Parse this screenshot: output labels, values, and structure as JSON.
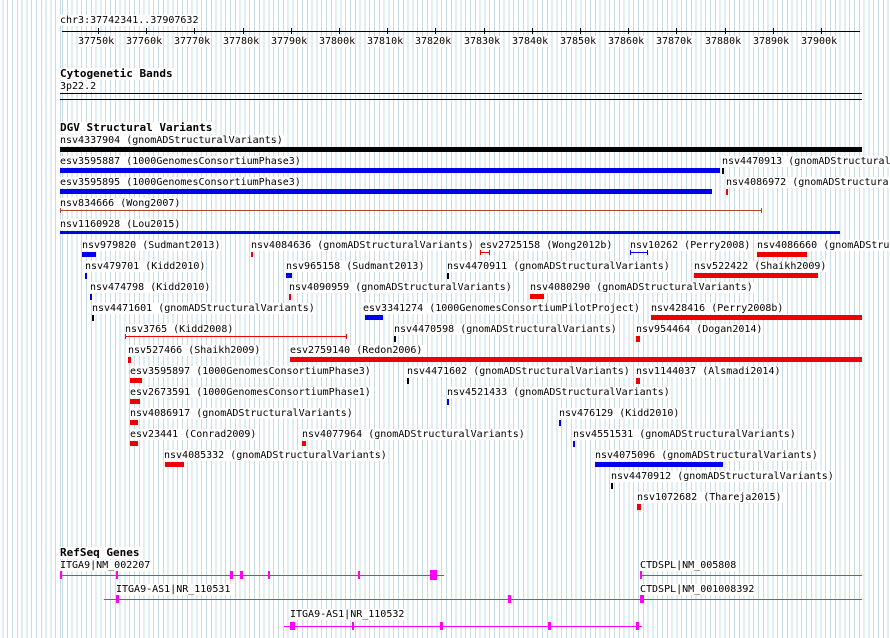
{
  "ruler": {
    "position": "chr3:37742341..37907632",
    "ticks": [
      "37750k",
      "37760k",
      "37770k",
      "37780k",
      "37790k",
      "37800k",
      "37810k",
      "37820k",
      "37830k",
      "37840k",
      "37850k",
      "37860k",
      "37870k",
      "37880k",
      "37890k",
      "37900k"
    ]
  },
  "tracks": {
    "cyto": {
      "title": "Cytogenetic Bands",
      "band": "3p22.2"
    },
    "dgv": {
      "title": "DGV Structural Variants"
    },
    "refseq": {
      "title": "RefSeq Genes"
    }
  },
  "colors": {
    "blue": "#0000ee",
    "red": "#ee0000",
    "black": "#000000",
    "brown": "#a84a2a",
    "magenta": "#ff00ff",
    "grid": "#c7dbe8"
  },
  "variants": [
    {
      "label": "nsv4337904 (gnomADStructuralVariants)",
      "color": "black"
    },
    {
      "label": "esv3595887 (1000GenomesConsortiumPhase3)",
      "color": "blue"
    },
    {
      "label": "nsv4470913 (gnomADStructural",
      "color": "black"
    },
    {
      "label": "esv3595895 (1000GenomesConsortiumPhase3)",
      "color": "blue"
    },
    {
      "label": "nsv4086972 (gnomADStructura",
      "color": "red"
    },
    {
      "label": "nsv834666 (Wong2007)",
      "color": "brown"
    },
    {
      "label": "nsv1160928 (Lou2015)",
      "color": "blue"
    },
    {
      "label": "nsv979820 (Sudmant2013)",
      "color": "blue"
    },
    {
      "label": "nsv4084636 (gnomADStructuralVariants)",
      "color": "red"
    },
    {
      "label": "esv2725158 (Wong2012b)",
      "color": "red"
    },
    {
      "label": "nsv10262 (Perry2008)",
      "color": "blue"
    },
    {
      "label": "nsv4086660 (gnomADStruc",
      "color": "red"
    },
    {
      "label": "nsv479701 (Kidd2010)",
      "color": "blue"
    },
    {
      "label": "nsv965158 (Sudmant2013)",
      "color": "blue"
    },
    {
      "label": "nsv4470911 (gnomADStructuralVariants)",
      "color": "black"
    },
    {
      "label": "nsv522422 (Shaikh2009)",
      "color": "red"
    },
    {
      "label": "nsv474798 (Kidd2010)",
      "color": "blue"
    },
    {
      "label": "nsv4090959 (gnomADStructuralVariants)",
      "color": "red"
    },
    {
      "label": "nsv4080290 (gnomADStructuralVariants)",
      "color": "red"
    },
    {
      "label": "nsv4471601 (gnomADStructuralVariants)",
      "color": "black"
    },
    {
      "label": "esv3341274 (1000GenomesConsortiumPilotProject)",
      "color": "blue"
    },
    {
      "label": "nsv428416 (Perry2008b)",
      "color": "red"
    },
    {
      "label": "nsv3765 (Kidd2008)",
      "color": "red"
    },
    {
      "label": "nsv4470598 (gnomADStructuralVariants)",
      "color": "black"
    },
    {
      "label": "nsv954464 (Dogan2014)",
      "color": "red"
    },
    {
      "label": "nsv527466 (Shaikh2009)",
      "color": "red"
    },
    {
      "label": "esv2759140 (Redon2006)",
      "color": "red"
    },
    {
      "label": "esv3595897 (1000GenomesConsortiumPhase3)",
      "color": "red"
    },
    {
      "label": "nsv4471602 (gnomADStructuralVariants)",
      "color": "black"
    },
    {
      "label": "nsv1144037 (Alsmadi2014)",
      "color": "red"
    },
    {
      "label": "esv2673591 (1000GenomesConsortiumPhase1)",
      "color": "red"
    },
    {
      "label": "nsv4521433 (gnomADStructuralVariants)",
      "color": "blue"
    },
    {
      "label": "nsv4086917 (gnomADStructuralVariants)",
      "color": "red"
    },
    {
      "label": "nsv476129 (Kidd2010)",
      "color": "blue"
    },
    {
      "label": "esv23441 (Conrad2009)",
      "color": "red"
    },
    {
      "label": "nsv4077964 (gnomADStructuralVariants)",
      "color": "red"
    },
    {
      "label": "nsv4551531 (gnomADStructuralVariants)",
      "color": "blue"
    },
    {
      "label": "nsv4085332 (gnomADStructuralVariants)",
      "color": "red"
    },
    {
      "label": "nsv4075096 (gnomADStructuralVariants)",
      "color": "blue"
    },
    {
      "label": "nsv4470912 (gnomADStructuralVariants)",
      "color": "black"
    },
    {
      "label": "nsv1072682 (Thareja2015)",
      "color": "red"
    }
  ],
  "genes": [
    {
      "label": "ITGA9|NM_002207"
    },
    {
      "label": "CTDSPL|NM_005808"
    },
    {
      "label": "ITGA9-AS1|NR_110531"
    },
    {
      "label": "CTDSPL|NM_001008392"
    },
    {
      "label": "ITGA9-AS1|NR_110532"
    }
  ]
}
